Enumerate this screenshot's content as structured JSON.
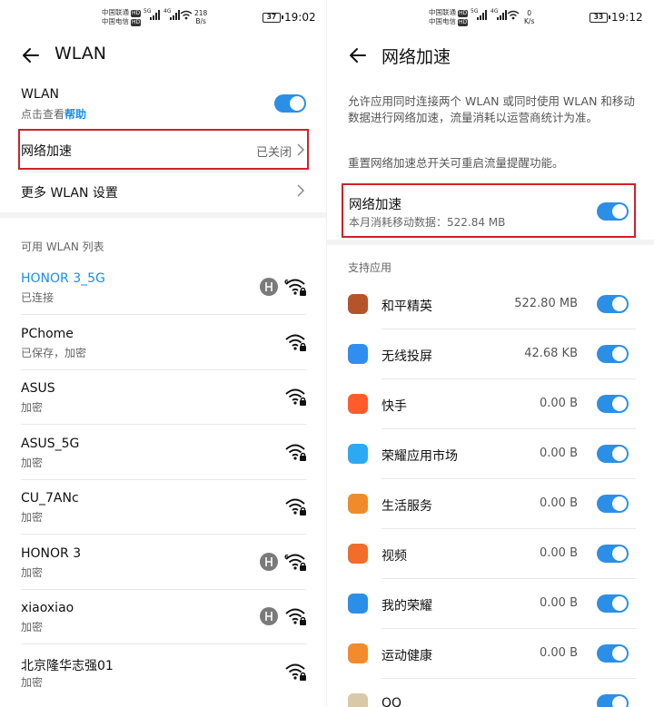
{
  "left": {
    "status": {
      "carrier1": "中国联通",
      "carrier2": "中国电信",
      "hd": "HD",
      "net1": "5G",
      "net2": "4G",
      "speed_value": "218",
      "speed_unit": "B/s",
      "battery": "37",
      "time": "19:02"
    },
    "header": {
      "title": "WLAN"
    },
    "wlan": {
      "label": "WLAN",
      "sub_prefix": "点击查看",
      "sub_link": "帮助",
      "enabled": true
    },
    "accel": {
      "label": "网络加速",
      "value": "已关闭"
    },
    "more": {
      "label": "更多 WLAN 设置"
    },
    "list_header": "可用 WLAN 列表",
    "networks": [
      {
        "name": "HONOR 3_5G",
        "status": "已连接",
        "share_icon": true,
        "icon": "wifi-6-lock-icon",
        "connected": true
      },
      {
        "name": "PChome",
        "status": "已保存，加密",
        "share_icon": false,
        "icon": "wifi-lock-icon"
      },
      {
        "name": "ASUS",
        "status": "加密",
        "share_icon": false,
        "icon": "wifi-lock-icon"
      },
      {
        "name": "ASUS_5G",
        "status": "加密",
        "share_icon": false,
        "icon": "wifi-lock-icon"
      },
      {
        "name": "CU_7ANc",
        "status": "加密",
        "share_icon": false,
        "icon": "wifi-lock-icon"
      },
      {
        "name": "HONOR 3",
        "status": "加密",
        "share_icon": true,
        "icon": "wifi-6-lock-icon"
      },
      {
        "name": "xiaoxiao",
        "status": "加密",
        "share_icon": true,
        "icon": "wifi-lock-icon"
      },
      {
        "name": "北京隆华志强01",
        "status": "加密",
        "share_icon": false,
        "icon": "wifi-lock-icon"
      }
    ]
  },
  "right": {
    "status": {
      "carrier1": "中国联通",
      "carrier2": "中国电信",
      "hd": "HD",
      "net1": "5G",
      "net2": "4G",
      "speed_value": "0",
      "speed_unit": "K/s",
      "battery": "33",
      "time": "19:12"
    },
    "header": {
      "title": "网络加速"
    },
    "desc1": "允许应用同时连接两个 WLAN 或同时使用 WLAN 和移动数据进行网络加速，流量消耗以运营商统计为准。",
    "desc2": "重置网络加速总开关可重启流量提醒功能。",
    "accel": {
      "label": "网络加速",
      "usage": "本月消耗移动数据：522.84 MB",
      "enabled": true
    },
    "apps_header": "支持应用",
    "apps": [
      {
        "name": "和平精英",
        "size": "522.80 MB",
        "color": "#b5542a",
        "icon": "game-app-icon",
        "enabled": true
      },
      {
        "name": "无线投屏",
        "size": "42.68 KB",
        "color": "#2f8ef0",
        "icon": "screen-cast-icon",
        "enabled": true
      },
      {
        "name": "快手",
        "size": "0.00 B",
        "color": "#ff5b2d",
        "icon": "kuaishou-icon",
        "enabled": true
      },
      {
        "name": "荣耀应用市场",
        "size": "0.00 B",
        "color": "#2ba9f3",
        "icon": "app-market-icon",
        "enabled": true
      },
      {
        "name": "生活服务",
        "size": "0.00 B",
        "color": "#f08a2b",
        "icon": "life-service-icon",
        "enabled": true
      },
      {
        "name": "视频",
        "size": "0.00 B",
        "color": "#f26d2a",
        "icon": "video-icon",
        "enabled": true
      },
      {
        "name": "我的荣耀",
        "size": "0.00 B",
        "color": "#2b8fe8",
        "icon": "my-honor-icon",
        "enabled": true
      },
      {
        "name": "运动健康",
        "size": "0.00 B",
        "color": "#f58a2a",
        "icon": "health-icon",
        "enabled": true
      },
      {
        "name": "QQ",
        "size": "",
        "color": "#d9c9a8",
        "icon": "qq-icon",
        "enabled": true
      }
    ]
  }
}
